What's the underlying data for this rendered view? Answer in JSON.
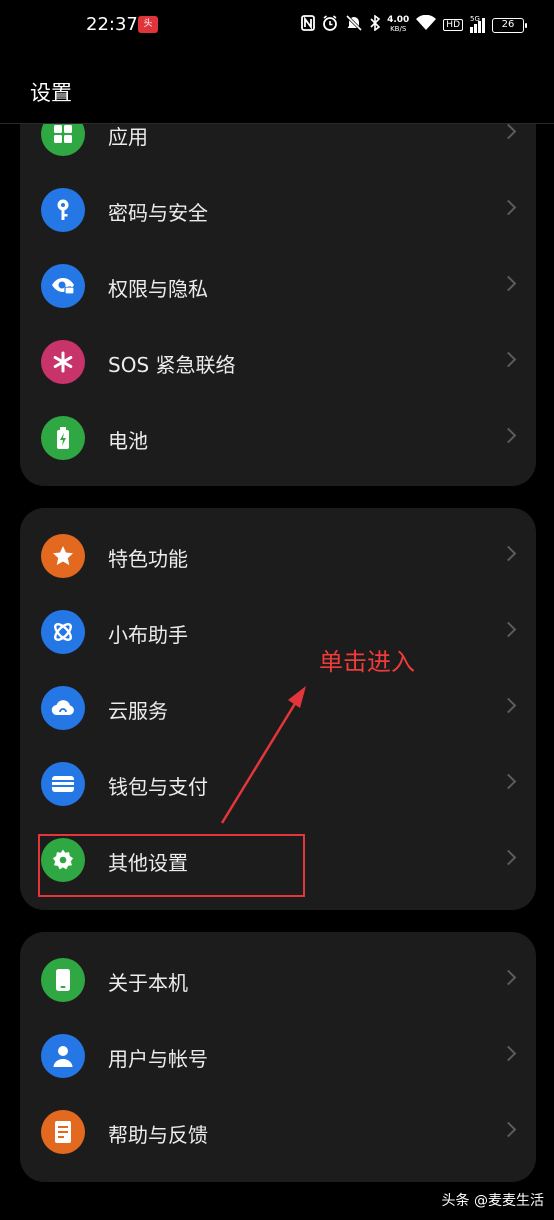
{
  "status_bar": {
    "time": "22:37",
    "notification_badge": "头条",
    "network_speed": "4.00",
    "network_speed_unit": "KB/S",
    "hd_label": "HD",
    "signal_label": "5G",
    "battery_level": "26"
  },
  "header": {
    "title": "设置"
  },
  "groups": [
    {
      "items": [
        {
          "label": "应用",
          "icon": "apps-icon",
          "color": "#2fa742"
        },
        {
          "label": "密码与安全",
          "icon": "key-icon",
          "color": "#2677e6"
        },
        {
          "label": "权限与隐私",
          "icon": "privacy-eye-icon",
          "color": "#2677e6"
        },
        {
          "label": "SOS 紧急联络",
          "icon": "sos-asterisk-icon",
          "color": "#c8336a"
        },
        {
          "label": "电池",
          "icon": "battery-icon",
          "color": "#2fa742"
        }
      ]
    },
    {
      "items": [
        {
          "label": "特色功能",
          "icon": "star-icon",
          "color": "#e2691f"
        },
        {
          "label": "小布助手",
          "icon": "assistant-icon",
          "color": "#2677e6"
        },
        {
          "label": "云服务",
          "icon": "cloud-icon",
          "color": "#2677e6"
        },
        {
          "label": "钱包与支付",
          "icon": "wallet-icon",
          "color": "#2677e6"
        },
        {
          "label": "其他设置",
          "icon": "gear-icon",
          "color": "#2fa742"
        }
      ]
    },
    {
      "items": [
        {
          "label": "关于本机",
          "icon": "phone-icon",
          "color": "#2fa742"
        },
        {
          "label": "用户与帐号",
          "icon": "user-icon",
          "color": "#2677e6"
        },
        {
          "label": "帮助与反馈",
          "icon": "help-book-icon",
          "color": "#e2691f"
        }
      ]
    }
  ],
  "annotation": {
    "text": "单击进入",
    "color": "#e4363a"
  },
  "watermark": "头条 @麦麦生活"
}
